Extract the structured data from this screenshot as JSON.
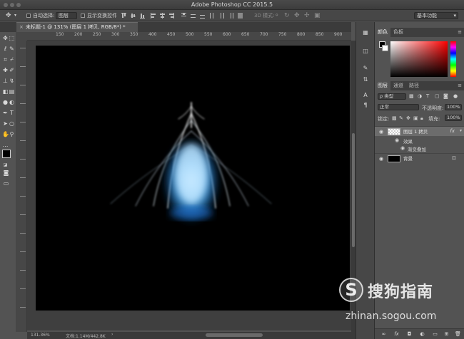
{
  "app": {
    "title": "Adobe Photoshop CC 2015.5"
  },
  "options_bar": {
    "auto_select_label": "自动选择:",
    "auto_select_value": "图层",
    "show_transform_label": "显示变换控件",
    "mode_3d_label": "3D 模式:",
    "workspace": "基本功能"
  },
  "document": {
    "tab_label": "未标题-1 @ 131% (图层 1 拷贝, RGB/8*) *"
  },
  "ruler": {
    "top_ticks": [
      "150",
      "200",
      "250",
      "300",
      "350",
      "400",
      "450",
      "500",
      "550",
      "600",
      "650",
      "700",
      "750",
      "800",
      "850",
      "900"
    ]
  },
  "status": {
    "zoom": "131.36%",
    "doc_size": "文档:1.14M/442.8K"
  },
  "color_panel": {
    "tab_color": "颜色",
    "tab_swatches": "色板",
    "foreground": "#000000",
    "background": "#ffffff"
  },
  "layers_panel": {
    "tab_layers": "图层",
    "tab_channels": "通道",
    "tab_paths": "路径",
    "filter_kind": "ρ 类型",
    "blend_mode": "正常",
    "opacity_label": "不透明度:",
    "opacity_value": "100%",
    "lock_label": "锁定:",
    "fill_label": "填充:",
    "fill_value": "100%",
    "layers": [
      {
        "name": "图层 1 拷贝",
        "fx": "fx"
      },
      {
        "name": "背景"
      }
    ],
    "effects_label": "效果",
    "gradient_overlay_label": "渐变叠加"
  },
  "watermark": {
    "logo_letter": "S",
    "brand": "搜狗指南",
    "url": "zhinan.sogou.com"
  },
  "accent_colors": {
    "glow_blue": "#49b6ff",
    "canvas_bg": "#000000"
  }
}
